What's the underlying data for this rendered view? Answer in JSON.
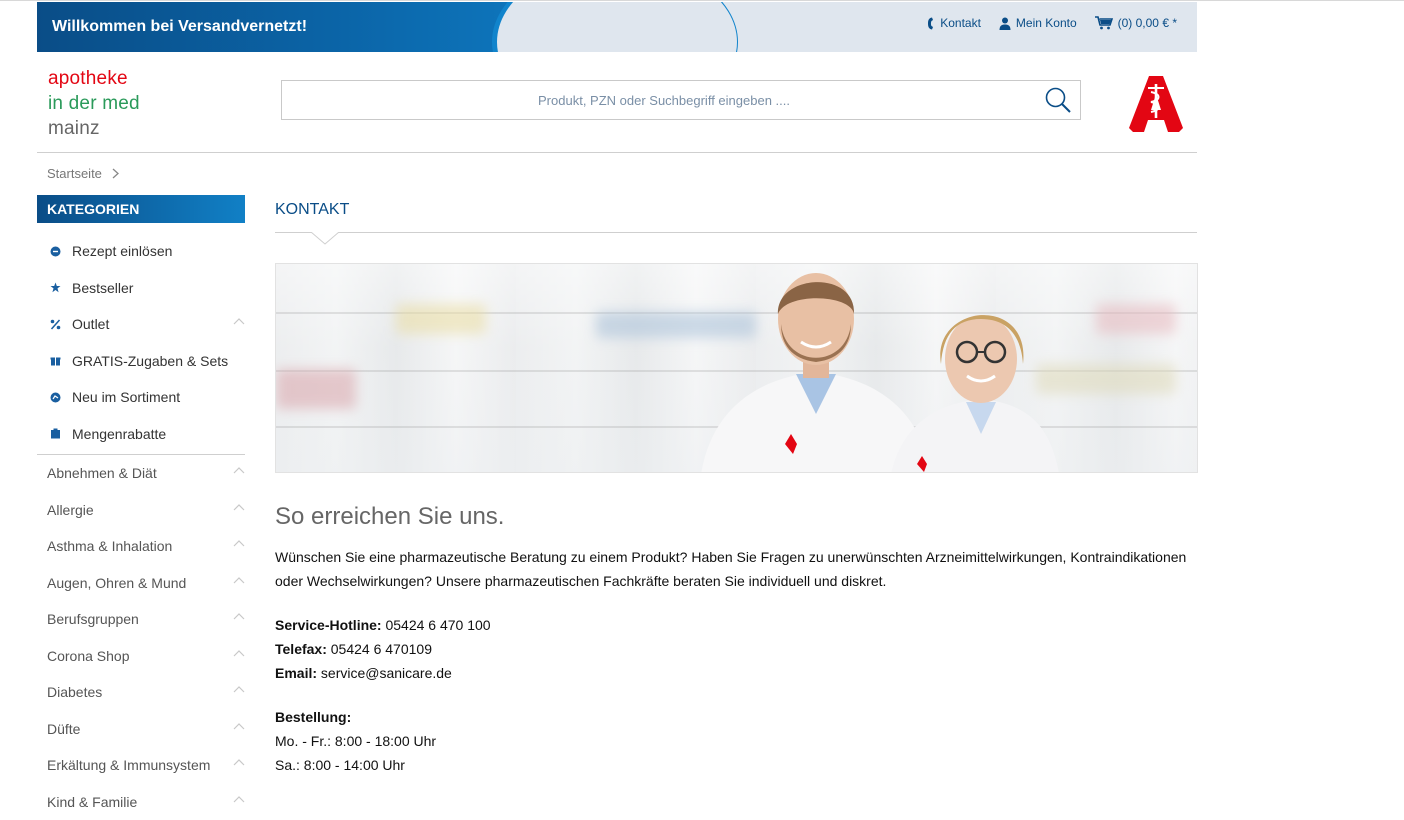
{
  "banner": {
    "welcome": "Willkommen bei Versandvernetzt!",
    "links": {
      "contact": "Kontakt",
      "account": "Mein Konto",
      "cart": "(0) 0,00 € *"
    }
  },
  "logo": {
    "line1": "apotheke",
    "line2": "in der med",
    "line3": "mainz"
  },
  "search": {
    "placeholder": "Produkt, PZN oder Suchbegriff eingeben ...."
  },
  "breadcrumb": {
    "home": "Startseite"
  },
  "sidebar": {
    "heading": "KATEGORIEN",
    "featured": [
      {
        "label": "Rezept einlösen",
        "icon": "prescription-icon"
      },
      {
        "label": "Bestseller",
        "icon": "star-icon"
      },
      {
        "label": "Outlet",
        "icon": "percent-icon"
      },
      {
        "label": "GRATIS-Zugaben & Sets",
        "icon": "gift-icon"
      },
      {
        "label": "Neu im Sortiment",
        "icon": "new-badge-icon"
      },
      {
        "label": "Mengenrabatte",
        "icon": "bag-icon"
      }
    ],
    "categories": [
      "Abnehmen & Diät",
      "Allergie",
      "Asthma & Inhalation",
      "Augen, Ohren & Mund",
      "Berufsgruppen",
      "Corona Shop",
      "Diabetes",
      "Düfte",
      "Erkältung & Immunsystem",
      "Kind & Familie"
    ]
  },
  "content": {
    "title": "KONTAKT",
    "subheading": "So erreichen Sie uns.",
    "intro": "Wünschen Sie eine pharmazeutische Beratung zu einem Produkt? Haben Sie Fragen zu unerwünschten Arzneimittelwirkungen, Kontraindikationen oder Wechselwirkungen? Unsere pharmazeutischen Fachkräfte beraten Sie individuell und diskret.",
    "hotline_label": "Service-Hotline:",
    "hotline_value": "05424 6 470 100",
    "fax_label": "Telefax:",
    "fax_value": "05424 6 470109",
    "email_label": "Email:",
    "email_value": "service@sanicare.de",
    "order_label": "Bestellung:",
    "hours_weekday": "Mo. - Fr.: 8:00 - 18:00 Uhr",
    "hours_saturday": "Sa.: 8:00 - 14:00 Uhr"
  },
  "colors": {
    "brand_blue": "#0a4d87",
    "accent_red": "#e30613",
    "logo_green": "#2a9a5a"
  }
}
